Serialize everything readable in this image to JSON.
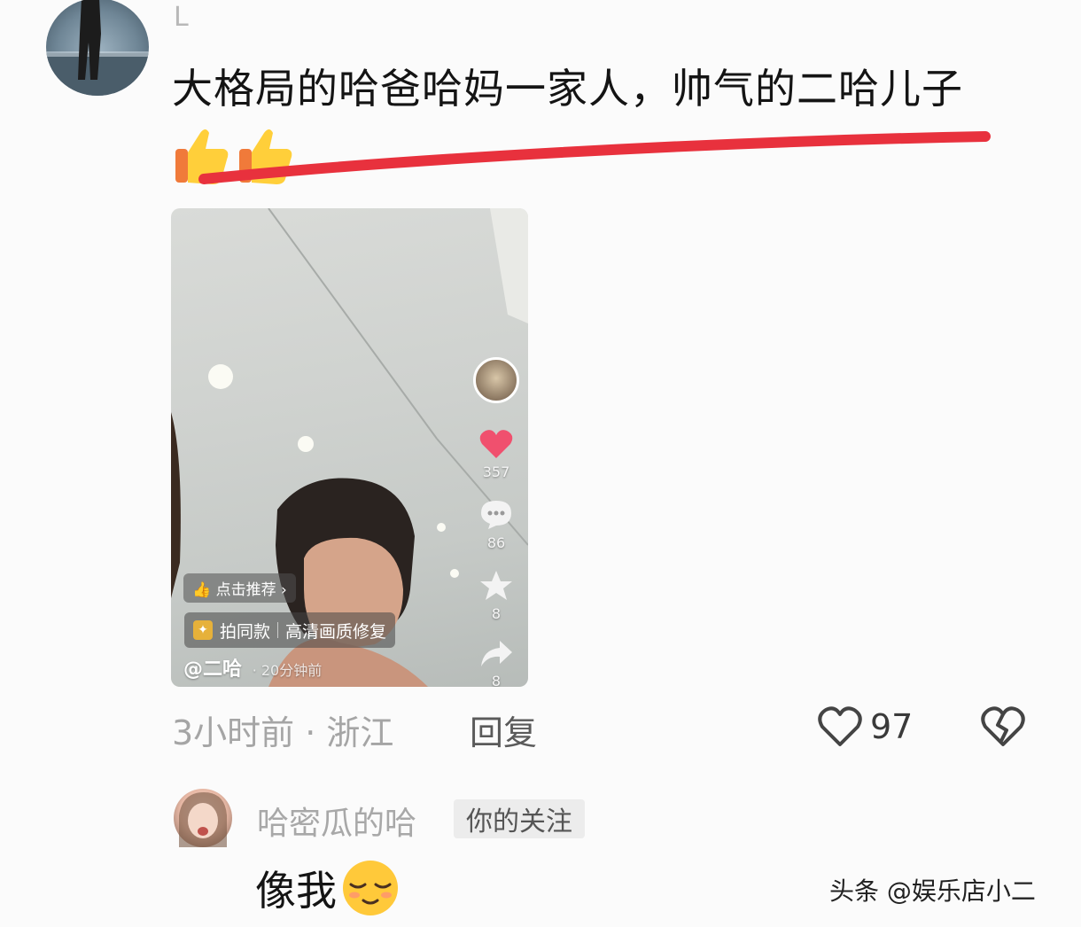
{
  "comment1": {
    "username": "L",
    "text": "大格局的哈爸哈妈一家人，帅气的二哈儿子",
    "emoji": "thumbs-up-emoji"
  },
  "video": {
    "likes": "357",
    "comments": "86",
    "favorites": "8",
    "shares": "8",
    "recommend_label": "点击推荐",
    "shoot_same": "拍同款",
    "hd_repair": "高清画质修复",
    "handle": "@二哈",
    "posted": "· 20分钟前"
  },
  "meta": {
    "time_location": "3小时前 · 浙江",
    "reply": "回复",
    "like_count": "97"
  },
  "comment2": {
    "username": "哈密瓜的哈",
    "badge": "你的关注",
    "text": "像我",
    "emoji": "relieved-face-emoji"
  },
  "watermark": "头条 @娱乐店小二",
  "colors": {
    "heart": "#f0506e",
    "accent_stroke": "#e8313d"
  }
}
